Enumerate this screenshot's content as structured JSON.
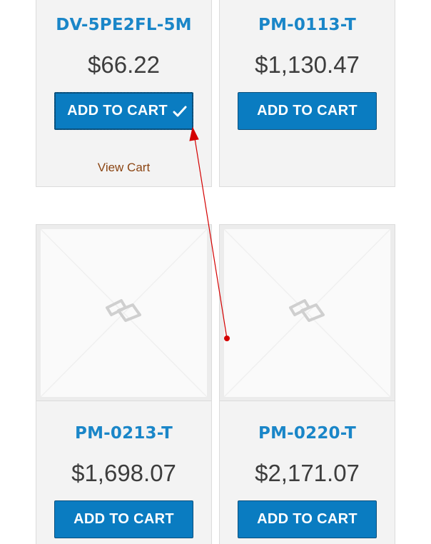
{
  "products": [
    {
      "sku": "DV-5PE2FL-5M",
      "price": "$66.22",
      "button_label": "ADD TO CART",
      "added": true,
      "view_cart_label": "View Cart"
    },
    {
      "sku": "PM-0113-T",
      "price": "$1,130.47",
      "button_label": "ADD TO CART",
      "added": false
    },
    {
      "sku": "PM-0213-T",
      "price": "$1,698.07",
      "button_label": "ADD TO CART",
      "added": false
    },
    {
      "sku": "PM-0220-T",
      "price": "$2,171.07",
      "button_label": "ADD TO CART",
      "added": false
    }
  ],
  "colors": {
    "sku": "#1a86c8",
    "button": "#0a7cc1",
    "price": "#3d3d3d",
    "view_cart": "#8b4513",
    "annotation_arrow": "#d40000"
  },
  "icons": {
    "added_indicator": "checkmark-icon",
    "image_placeholder": "image-placeholder-icon",
    "annotation": "red-arrow-annotation"
  }
}
